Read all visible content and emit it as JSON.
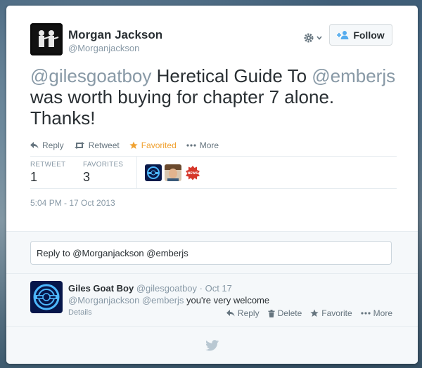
{
  "tweet": {
    "author_name": "Morgan Jackson",
    "author_handle": "@Morganjackson",
    "text_mention_1": "@gilesgoatboy",
    "text_part_1": " Heretical Guide To ",
    "text_mention_2": "@emberjs",
    "text_part_2": " was worth buying for chapter 7 alone. Thanks!",
    "timestamp": "5:04 PM - 17 Oct 2013"
  },
  "header": {
    "follow_label": "Follow",
    "gear_icon": "gear-icon"
  },
  "actions": {
    "reply": "Reply",
    "retweet": "Retweet",
    "favorited": "Favorited",
    "more": "More"
  },
  "stats": {
    "retweet_label": "RETWEET",
    "retweet_count": "1",
    "favorites_label": "FAVORITES",
    "favorites_count": "3"
  },
  "reply_box": {
    "value": "Reply to @Morganjackson @emberjs"
  },
  "reply": {
    "name": "Giles Goat Boy",
    "meta": "@gilesgoatboy · Oct 17",
    "mention_1": "@Morganjackson",
    "mention_2": "@emberjs",
    "body": " you're very welcome",
    "details": "Details",
    "actions": {
      "reply": "Reply",
      "delete": "Delete",
      "favorite": "Favorite",
      "more": "More"
    }
  },
  "colors": {
    "accent": "#55acee",
    "favorited": "#f0a130",
    "muted": "#8899a6",
    "text": "#292f33"
  },
  "footer": {
    "icon": "twitter-bird-icon"
  }
}
